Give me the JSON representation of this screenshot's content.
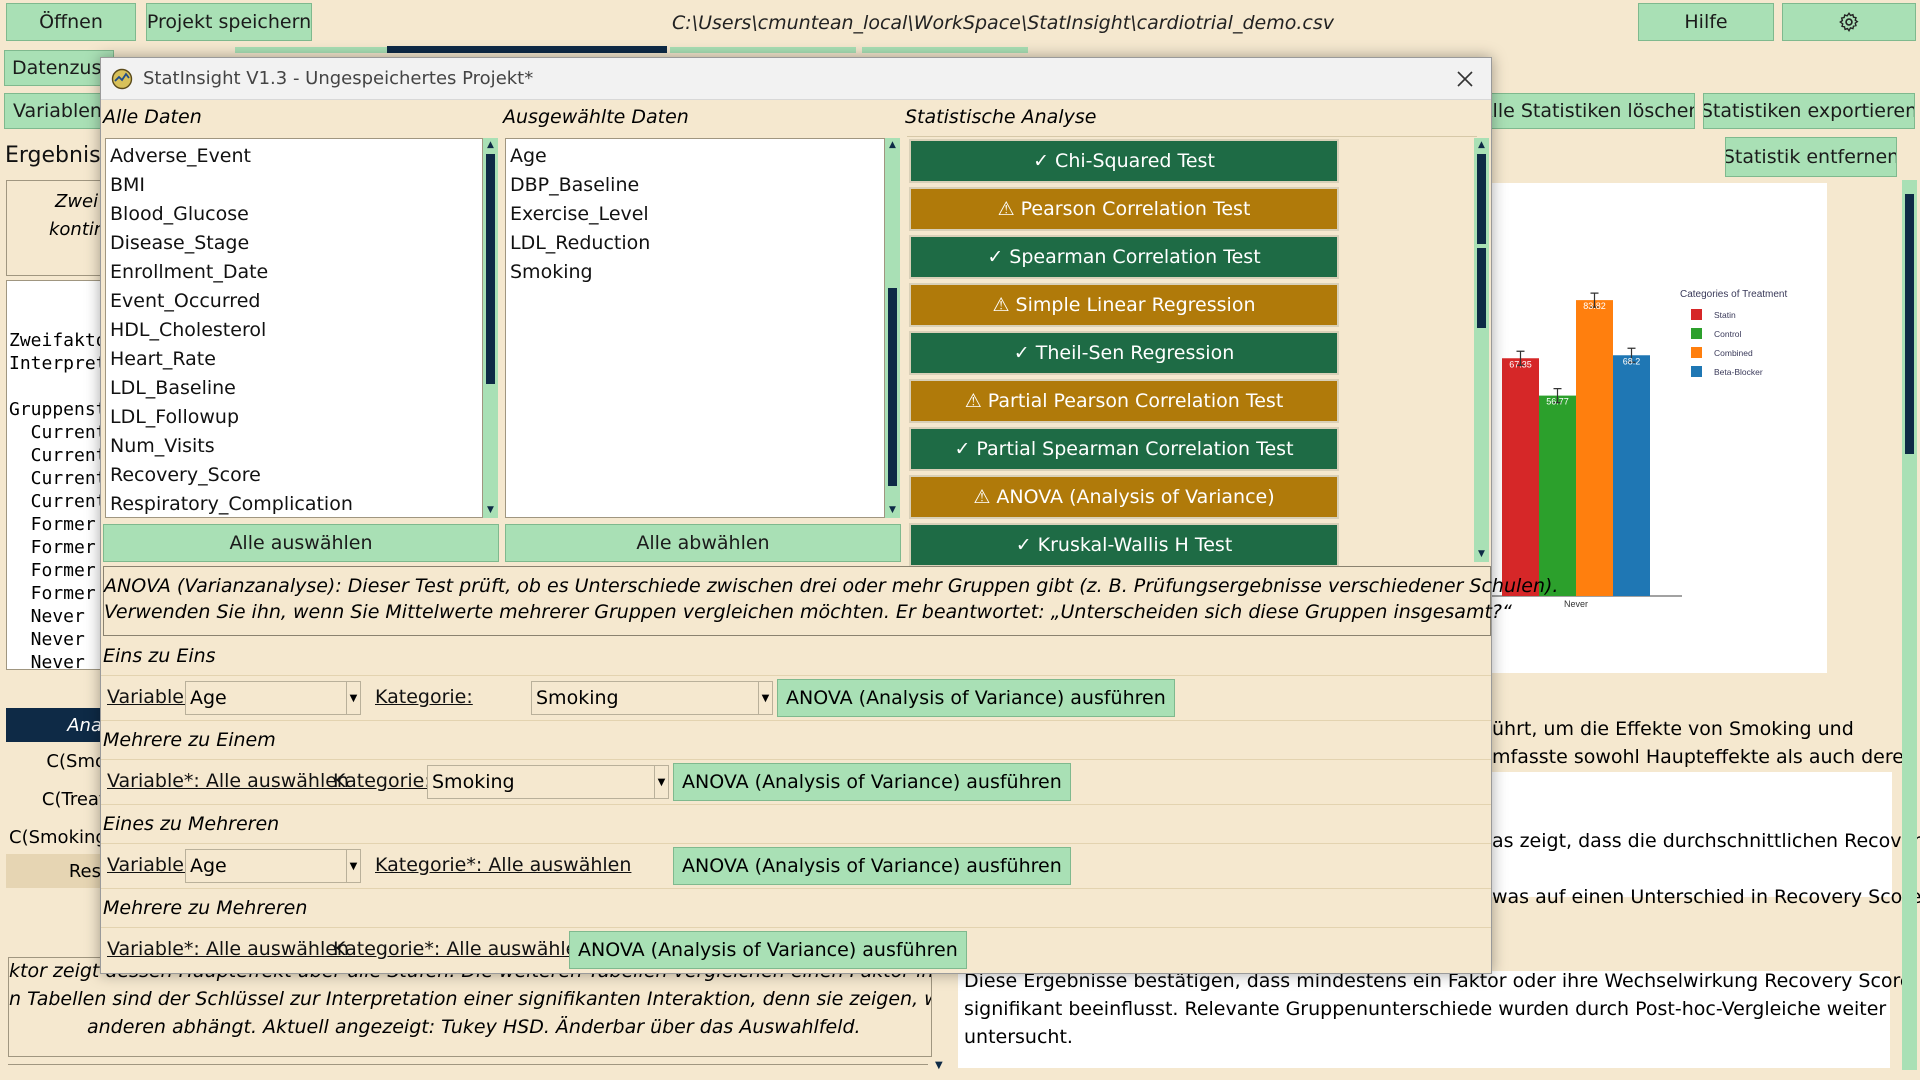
{
  "topbar": {
    "open_label": "Öffnen",
    "save_label": "Projekt speichern",
    "file_path": "C:\\Users\\cmuntean_local\\WorkSpace\\StatInsight\\cardiotrial_demo.csv",
    "help_label": "Hilfe",
    "settings_icon": "gear-icon"
  },
  "background": {
    "tab_partial_1": "Datenzusa",
    "row2_left": "Variablent",
    "clear_all_stats": "Alle Statistiken löschen",
    "export_stats": "Statistiken exportieren",
    "results_heading": "Ergebnis",
    "remove_stat": "Statistik entfernen",
    "results_box_text_1": "Zwei",
    "results_box_text_2": "kontin",
    "mono_lines": [
      "Zweifakto",
      "Interpret",
      "",
      "Gruppenst",
      "  Current",
      "  Current",
      "  Current",
      "  Current",
      "  Former",
      "  Former",
      "  Former",
      "  Former",
      "  Never",
      "  Never",
      "  Never",
      "  Never"
    ],
    "anova_header": "Ana",
    "anova_rows": [
      "C(Smo",
      "C(Treat",
      "C(Smoking",
      "Resi"
    ],
    "right_text_1a": "ührt, um die Effekte von Smoking und",
    "right_text_1b": "mfasste sowohl Haupteffekte als auch deren",
    "right_text_2": "as zeigt, dass die durchschnittlichen Recovery",
    "right_text_3": "was auf einen Unterschied in Recovery Score",
    "right_text_4a": "Diese Ergebnisse bestätigen, dass mindestens ein Faktor oder ihre Wechselwirkung Recovery Score",
    "right_text_4b": "signifikant beeinflusst. Relevante Gruppenunterschiede wurden durch Post-hoc-Vergleiche weiter",
    "right_text_4c": "untersucht.",
    "left_bottom_1": "ktor zeigt dessen Haupteffekt über alle Stufen. Die weiteren Tabellen vergleichen einen Faktor innerhalb je",
    "left_bottom_2": "n Tabellen sind der Schlüssel zur Interpretation einer signifikanten Interaktion, denn sie zeigen, wo der Effe",
    "left_bottom_3": "anderen abhängt. Aktuell angezeigt: Tukey HSD. Änderbar über das Auswahlfeld."
  },
  "chart_data": {
    "type": "bar",
    "categories": [
      "Never"
    ],
    "legend_title": "Categories of  Treatment",
    "legend_placement": "top-right",
    "series": [
      {
        "name": "Statin",
        "values": [
          67.35
        ],
        "color": "#d62728"
      },
      {
        "name": "Control",
        "values": [
          56.77
        ],
        "color": "#2ca02c"
      },
      {
        "name": "Combined",
        "values": [
          83.82
        ],
        "color": "#ff7f0e"
      },
      {
        "name": "Beta-Blocker",
        "values": [
          68.2
        ],
        "color": "#1f77b4"
      }
    ],
    "bar_labels": [
      "67.35",
      "56.77",
      "83.82",
      "68.2"
    ],
    "ylim": [
      0,
      100
    ]
  },
  "dialog": {
    "title": "StatInsight V1.3 - Ungespeichertes Projekt*",
    "close_icon": "close-icon",
    "col_all_data": "Alle Daten",
    "col_selected": "Ausgewählte Daten",
    "col_analysis": "Statistische Analyse",
    "all_data_items": [
      "Adverse_Event",
      "BMI",
      "Blood_Glucose",
      "Disease_Stage",
      "Enrollment_Date",
      "Event_Occurred",
      "HDL_Cholesterol",
      "Heart_Rate",
      "LDL_Baseline",
      "LDL_Followup",
      "Num_Visits",
      "Recovery_Score",
      "Respiratory_Complication"
    ],
    "selected_items": [
      "Age",
      "DBP_Baseline",
      "Exercise_Level",
      "LDL_Reduction",
      "Smoking"
    ],
    "select_all": "Alle auswählen",
    "deselect_all": "Alle abwählen",
    "tests": [
      {
        "label": "✓ Chi-Squared Test",
        "status": "ok"
      },
      {
        "label": "⚠ Pearson Correlation Test",
        "status": "warn"
      },
      {
        "label": "✓ Spearman Correlation Test",
        "status": "ok"
      },
      {
        "label": "⚠ Simple Linear Regression",
        "status": "warn"
      },
      {
        "label": "✓ Theil-Sen Regression",
        "status": "ok"
      },
      {
        "label": "⚠ Partial Pearson Correlation Test",
        "status": "warn"
      },
      {
        "label": "✓ Partial Spearman Correlation Test",
        "status": "ok"
      },
      {
        "label": "⚠ ANOVA (Analysis of Variance)",
        "status": "warn"
      },
      {
        "label": "✓ Kruskal-Wallis H Test",
        "status": "ok"
      }
    ],
    "description_1": "ANOVA (Varianzanalyse): Dieser Test prüft, ob es Unterschiede zwischen drei oder mehr Gruppen gibt (z. B. Prüfungsergebnisse verschiedener Schulen).",
    "description_2": "Verwenden Sie ihn, wenn Sie Mittelwerte mehrerer Gruppen vergleichen möchten. Er beantwortet: „Unterscheiden sich diese Gruppen insgesamt?“",
    "section_one_to_one": "Eins zu Eins",
    "section_many_to_one": "Mehrere zu Einem",
    "section_one_to_many": "Eines zu Mehreren",
    "section_many_to_many": "Mehrere zu Mehreren",
    "variable_label": "Variable:",
    "category_label": "Kategorie:",
    "variable_all": "Variable*: Alle auswählen",
    "category_all": "Kategorie*: Alle auswählen",
    "variable_value": "Age",
    "category_value": "Smoking",
    "run_label": "ANOVA (Analysis of Variance) ausführen"
  }
}
